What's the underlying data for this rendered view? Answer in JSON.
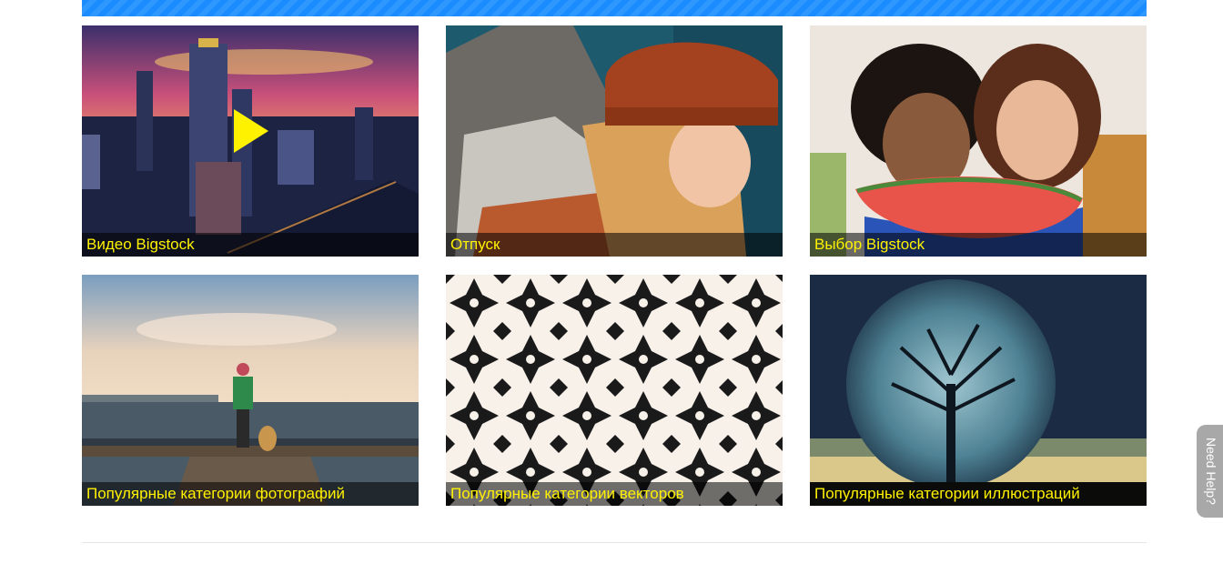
{
  "gallery": {
    "tiles": [
      {
        "label": "Видео Bigstock",
        "icon": "play-icon"
      },
      {
        "label": "Отпуск"
      },
      {
        "label": "Выбор Bigstock"
      },
      {
        "label": "Популярные категории фотографий"
      },
      {
        "label": "Популярные категории векторов"
      },
      {
        "label": "Популярные категории иллюстраций"
      }
    ]
  },
  "help": {
    "label": "Need Help?"
  },
  "colors": {
    "caption_text": "#fff200",
    "banner": "#1a8cff"
  }
}
